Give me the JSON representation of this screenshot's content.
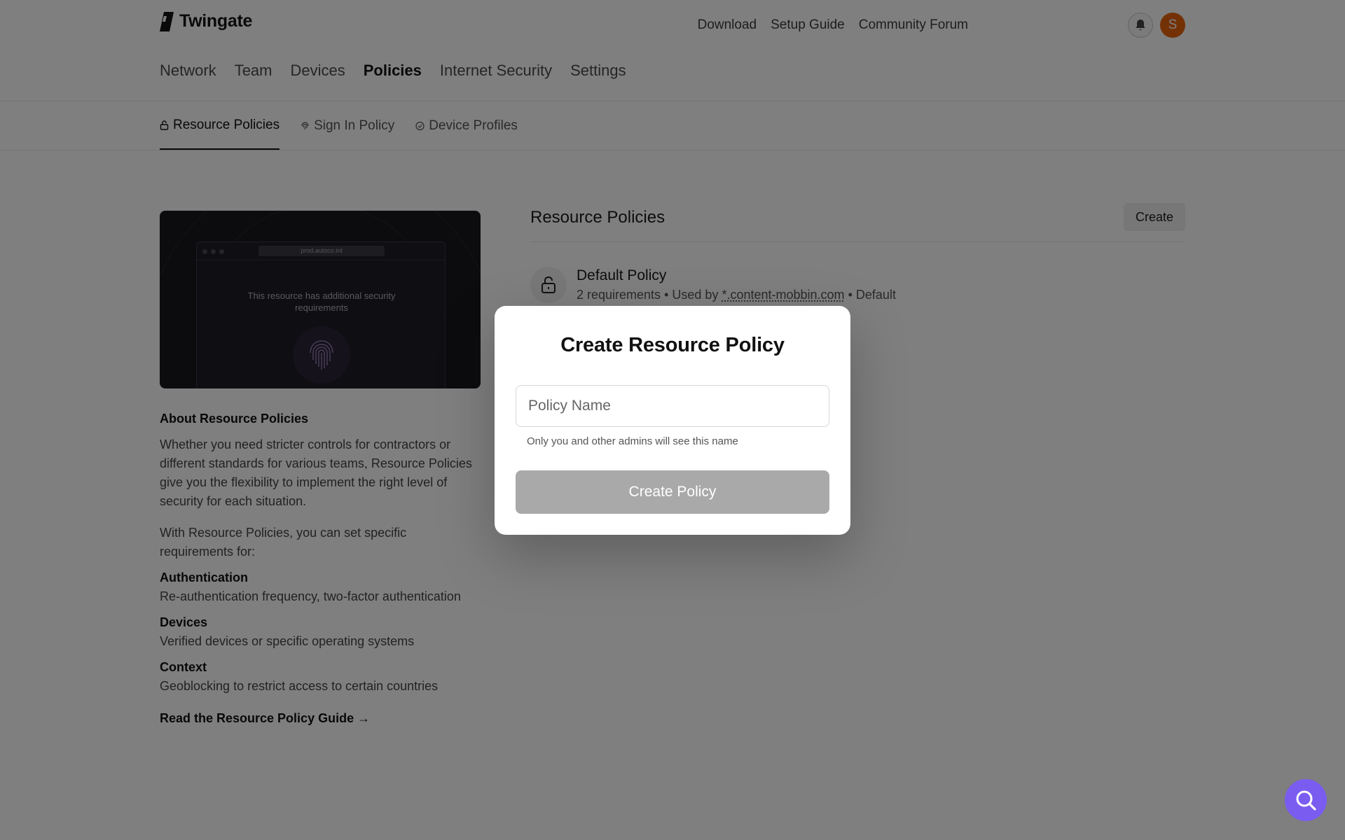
{
  "brand": {
    "name": "Twingate"
  },
  "header": {
    "links": [
      "Download",
      "Setup Guide",
      "Community Forum"
    ],
    "avatar_initial": "S"
  },
  "main_nav": [
    "Network",
    "Team",
    "Devices",
    "Policies",
    "Internet Security",
    "Settings"
  ],
  "main_nav_active": "Policies",
  "sub_nav": [
    {
      "label": "Resource Policies",
      "icon": "lock-icon",
      "active": true
    },
    {
      "label": "Sign In Policy",
      "icon": "fingerprint-icon",
      "active": false
    },
    {
      "label": "Device Profiles",
      "icon": "check-circle-icon",
      "active": false
    }
  ],
  "hero": {
    "url": "prod.autoco.int",
    "message": "This resource has additional security requirements"
  },
  "about": {
    "title": "About Resource Policies",
    "p1": "Whether you need stricter controls for contractors or different standards for various teams, Resource Policies give you the flexibility to implement the right level of security for each situation.",
    "p2": "With Resource Policies, you can set specific requirements for:",
    "features": [
      {
        "title": "Authentication",
        "desc": "Re-authentication frequency, two-factor authentication"
      },
      {
        "title": "Devices",
        "desc": "Verified devices or specific operating systems"
      },
      {
        "title": "Context",
        "desc": "Geoblocking to restrict access to certain countries"
      }
    ],
    "guide_link": "Read the Resource Policy Guide →"
  },
  "resource_policies": {
    "title": "Resource Policies",
    "create_label": "Create",
    "policies": [
      {
        "name": "Default Policy",
        "requirements": "2 requirements",
        "used_by_prefix": "Used by",
        "used_by": "*.content-mobbin.com",
        "tag": "Default",
        "separator": "•"
      }
    ]
  },
  "modal": {
    "title": "Create Resource Policy",
    "input_placeholder": "Policy Name",
    "input_value": "",
    "hint": "Only you and other admins will see this name",
    "submit_label": "Create Policy"
  },
  "colors": {
    "avatar": "#e8620d",
    "help_button": "#7b5cf0",
    "submit_disabled": "#a9a9a9"
  }
}
